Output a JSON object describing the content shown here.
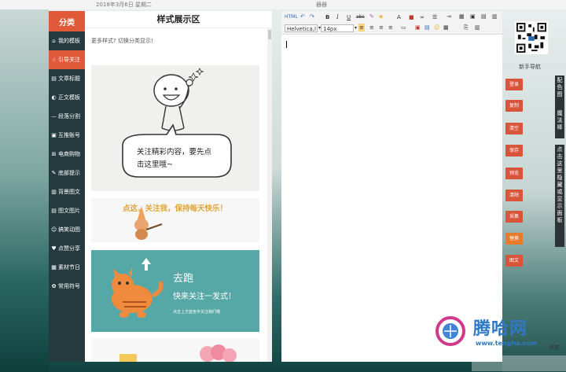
{
  "top_bar": {
    "date": "2018年3月6日 星期二",
    "center": "器器"
  },
  "sidebar": {
    "header": "分类",
    "items": [
      {
        "icon": "home-icon",
        "glyph": "⌂",
        "label": "我的模板"
      },
      {
        "icon": "attention-icon",
        "glyph": "☝",
        "label": "引导关注",
        "active": true
      },
      {
        "icon": "title-icon",
        "glyph": "▤",
        "label": "文章标题"
      },
      {
        "icon": "text-icon",
        "glyph": "◐",
        "label": "正文模板"
      },
      {
        "icon": "divider-icon",
        "glyph": "—",
        "label": "段落分割"
      },
      {
        "icon": "account-icon",
        "glyph": "▣",
        "label": "互推账号"
      },
      {
        "icon": "cart-icon",
        "glyph": "⊞",
        "label": "电商购物"
      },
      {
        "icon": "bottom-icon",
        "glyph": "✎",
        "label": "底部提示"
      },
      {
        "icon": "background-icon",
        "glyph": "▥",
        "label": "背景图文"
      },
      {
        "icon": "image-icon",
        "glyph": "▤",
        "label": "图文图片"
      },
      {
        "icon": "funny-icon",
        "glyph": "☺",
        "label": "搞笑动图"
      },
      {
        "icon": "like-icon",
        "glyph": "♥",
        "label": "点赞分享"
      },
      {
        "icon": "festival-icon",
        "glyph": "▦",
        "label": "素材节日"
      },
      {
        "icon": "symbol-icon",
        "glyph": "✿",
        "label": "常用符号"
      }
    ]
  },
  "style_panel": {
    "title": "样式展示区",
    "hint": "更多样式?  切换分类显示!",
    "tile1_text_line1": "关注精彩内容，要先点",
    "tile1_text_line2": "击这里哦~",
    "tile2_text": "点这，关注我，保持每天快乐！",
    "tile3_title": "去跑",
    "tile3_line": "快来关注一发式！",
    "tile3_small": "点击上方蓝色字关注我们哦"
  },
  "editor": {
    "toolbar": {
      "html": "HTML",
      "undo": "↶",
      "redo": "↷",
      "bold": "B",
      "italic": "I",
      "underline": "U",
      "strike": "abc",
      "font_family": "Helvetica,I",
      "font_size": "14px",
      "font_color": "A",
      "list": "☰"
    },
    "content": ""
  },
  "right_panel": {
    "qr_caption": "新手导航",
    "buttons": [
      "登录",
      "复制",
      "清空",
      "保存",
      "预览",
      "清除",
      "采集",
      "替换",
      "图文"
    ],
    "vertical_tab1": "配色图",
    "vertical_tab2": "魔法棒",
    "vertical_tab3": "点击这里隐藏或显示面板"
  },
  "watermark": {
    "name": "腾哈网",
    "url": "www.tengha.com",
    "corner": "开放"
  },
  "colors": {
    "accent": "#e05a3a",
    "sidebar": "#243a3e",
    "teal": "#56a8a6"
  }
}
